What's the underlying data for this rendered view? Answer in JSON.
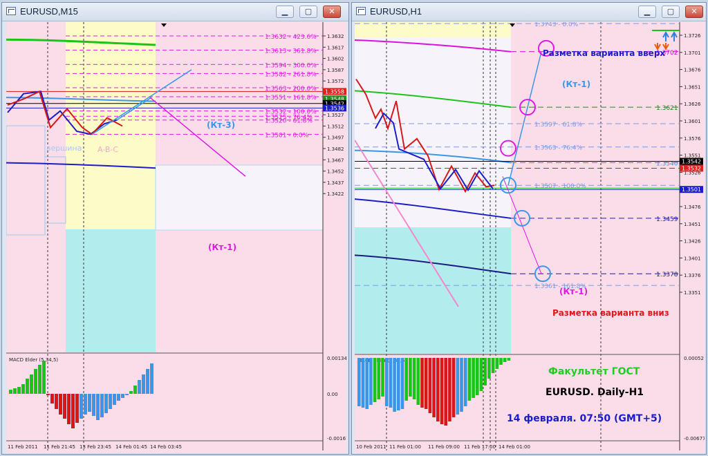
{
  "left_window": {
    "title": "EURUSD,M15",
    "fib_labels": [
      {
        "text": "1.3632 - 423.6%",
        "price": 1.3632
      },
      {
        "text": "1.3613 - 361.8%",
        "price": 1.3613
      },
      {
        "text": "1.3594 - 300.0%",
        "price": 1.3594
      },
      {
        "text": "1.3582 - 261.8%",
        "price": 1.3582
      },
      {
        "text": "1.3563 - 200.0%",
        "price": 1.3563
      },
      {
        "text": "1.3551 - 161.8%",
        "price": 1.3551
      },
      {
        "text": "1.3532 - 100.0%",
        "price": 1.3532
      },
      {
        "text": "1.3525 - 76.4%",
        "price": 1.3525
      },
      {
        "text": "1.3520 - 61.8%",
        "price": 1.352
      },
      {
        "text": "1.3501 - 0.0%",
        "price": 1.3501
      }
    ],
    "price_ticks": [
      "1.3632",
      "1.3617",
      "1.3602",
      "1.3587",
      "1.3572",
      "1.3557",
      "1.3542",
      "1.3527",
      "1.3512",
      "1.3497",
      "1.3482",
      "1.3467",
      "1.3452",
      "1.3437",
      "1.3422"
    ],
    "price_badges": [
      {
        "text": "1.3558",
        "color": "#e02020"
      },
      {
        "text": "1.3548",
        "color": "#228b22"
      },
      {
        "text": "1.3542",
        "color": "#000000"
      },
      {
        "text": "1.3536",
        "color": "#1c1cc8"
      }
    ],
    "annotations": [
      "(Кт-3)",
      "(Кт-1)"
    ],
    "faint_labels": [
      "вершина",
      "A-B-C"
    ],
    "macd_label": "MACD Elder (5,34,5)",
    "macd_ticks": [
      "0.00134",
      "0.00",
      "-0.00167"
    ],
    "time_labels": [
      "11 Feb 2011",
      "11 Feb 21:45",
      "13 Feb 23:45",
      "14 Feb 01:45",
      "14 Feb 03:45"
    ]
  },
  "right_window": {
    "title": "EURUSD,H1",
    "fib_labels": [
      {
        "text": "1.3743 - 0.0%",
        "price": 1.3743
      },
      {
        "text": "1.3597 - 61.8%",
        "price": 1.3597
      },
      {
        "text": "1.3563 - 76.4%",
        "price": 1.3563
      },
      {
        "text": "1.3507 - 100.0%",
        "price": 1.3507
      },
      {
        "text": "1.3361 - 161.8%",
        "price": 1.3361
      }
    ],
    "level_labels": [
      {
        "text": "1.3702",
        "price": 1.3702,
        "color": "#cc00cc"
      },
      {
        "text": "1.3621",
        "price": 1.3621,
        "color": "#1e8a1e"
      },
      {
        "text": "1.3540",
        "price": 1.354,
        "color": "#3a8fd8"
      },
      {
        "text": "1.3459",
        "price": 1.3459,
        "color": "#1c1cc8"
      },
      {
        "text": "1.3378",
        "price": 1.3378,
        "color": "#1c1c80"
      }
    ],
    "price_ticks": [
      "1.3726",
      "1.3701",
      "1.3676",
      "1.3651",
      "1.3626",
      "1.3601",
      "1.3576",
      "1.3551",
      "1.3526",
      "1.3501",
      "1.3476",
      "1.3451",
      "1.3426",
      "1.3401",
      "1.3376",
      "1.3351"
    ],
    "price_badges": [
      {
        "text": "1.3542",
        "color": "#000000"
      },
      {
        "text": "1.3532",
        "color": "#e02020"
      },
      {
        "text": "1.3501",
        "color": "#1c1cc8"
      }
    ],
    "annotations": {
      "up_variant": "Разметка варианта вверх",
      "down_variant": "Разметка варианта вниз",
      "kt1_top": "(Кт-1)",
      "kt1_bottom": "(Кт-1)",
      "faculty": "Факультет ГОСТ",
      "subtitle": "EURUSD. Daily-H1",
      "date": "14 февраля. 07:50 (GMT+5)"
    },
    "macd_label": "MACD Elder (5,34,5)",
    "macd_ticks": [
      "0.00052",
      "-0.00677"
    ],
    "time_labels": [
      "10 Feb 2011",
      "11 Feb 01:00",
      "11 Feb 09:00",
      "11 Feb 17:00",
      "14 Feb 01:00"
    ]
  },
  "colors": {
    "chart_bg": "#fbdde9",
    "yellow_zone": "#fdfbc8",
    "cyan_zone": "#b2ecec",
    "white_zone": "#f6f4fa",
    "magenta": "#e018e0",
    "blue": "#1c1cc8",
    "red": "#d81818",
    "green": "#19c519",
    "light_blue": "#3a96e8"
  }
}
